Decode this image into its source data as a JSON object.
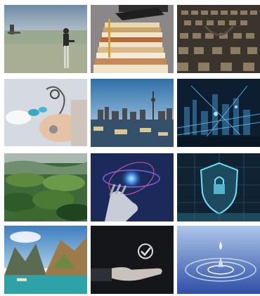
{
  "gallery": {
    "tiles": [
      {
        "icon": "field-person-image"
      },
      {
        "icon": "books-graduation-cap-image"
      },
      {
        "icon": "auditorium-seats-image"
      },
      {
        "icon": "medical-stethoscope-image"
      },
      {
        "icon": "harbor-city-skyline-image"
      },
      {
        "icon": "digital-city-network-image"
      },
      {
        "icon": "green-hills-landscape-image"
      },
      {
        "icon": "robot-hand-globe-image"
      },
      {
        "icon": "cyber-security-shield-image"
      },
      {
        "icon": "mountain-lake-image"
      },
      {
        "icon": "hand-checkmark-image"
      },
      {
        "icon": "water-drop-ripple-image"
      }
    ]
  }
}
